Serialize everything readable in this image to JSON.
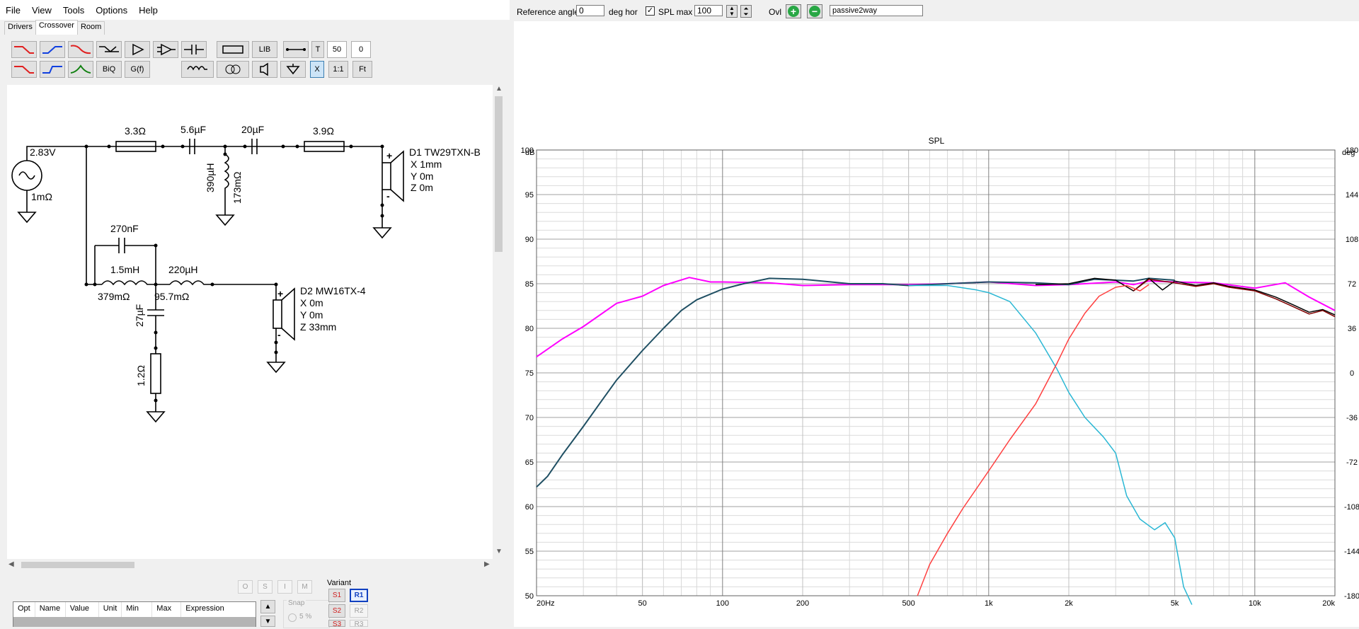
{
  "menu": [
    "File",
    "View",
    "Tools",
    "Options",
    "Help"
  ],
  "tabs": [
    {
      "label": "Drivers"
    },
    {
      "label": "Crossover",
      "active": true
    },
    {
      "label": "Room"
    }
  ],
  "toolbar": {
    "lib": "LIB",
    "t": "T",
    "val50": "50",
    "val0": "0",
    "biq": "BiQ",
    "gf": "G(f)",
    "x": "X",
    "one": "1:1",
    "fit": "Ft"
  },
  "schematic": {
    "source": {
      "voltage": "2.83V",
      "resistance": "1mΩ"
    },
    "tweeter_branch": {
      "r1": "3.3Ω",
      "c1": "5.6µF",
      "l1": "390µH",
      "l1r": "173mΩ",
      "c2": "20µF",
      "r2": "3.9Ω"
    },
    "woofer_branch": {
      "c1": "270nF",
      "l1": "1.5mH",
      "l1r": "379mΩ",
      "l2": "220µH",
      "l2r": "95.7mΩ",
      "c2": "27µF",
      "r1": "1.2Ω"
    },
    "drivers": [
      {
        "name": "D1 TW29TXN-B",
        "x": "X 1mm",
        "y": "Y 0m",
        "z": "Z 0m"
      },
      {
        "name": "D2 MW16TX-4",
        "x": "X 0m",
        "y": "Y 0m",
        "z": "Z 33mm"
      }
    ],
    "plus": "+",
    "minus": "-"
  },
  "bottom": {
    "buttons": [
      "O",
      "S",
      "I",
      "M"
    ],
    "snap": "Snap",
    "snap_val": "5 %",
    "variant_label": "Variant",
    "variants_s": [
      "S1",
      "S2",
      "S3"
    ],
    "variants_r": [
      "R1",
      "R2",
      "R3"
    ],
    "grid_cols": [
      "Opt",
      "Name",
      "Value",
      "Unit",
      "Min",
      "Max",
      "Expression"
    ]
  },
  "topbar": {
    "ref_angle_label": "Reference angle",
    "ref_angle_value": "0",
    "deg_hor": "deg hor",
    "spl_max_label": "SPL max",
    "spl_max_value": "100",
    "ovl_label": "Ovl",
    "project_name": "passive2way"
  },
  "chart_data": {
    "type": "line",
    "title": "SPL",
    "xscale": "log",
    "xlim": [
      20,
      20000
    ],
    "ylim": [
      50,
      100
    ],
    "y2lim": [
      -180,
      180
    ],
    "ylabel_unit": "dB",
    "y2label_unit": "deg",
    "xticks": [
      {
        "v": 20,
        "l": "20Hz"
      },
      {
        "v": 50,
        "l": "50"
      },
      {
        "v": 100,
        "l": "100"
      },
      {
        "v": 200,
        "l": "200"
      },
      {
        "v": 500,
        "l": "500"
      },
      {
        "v": 1000,
        "l": "1k"
      },
      {
        "v": 2000,
        "l": "2k"
      },
      {
        "v": 5000,
        "l": "5k"
      },
      {
        "v": 10000,
        "l": "10k"
      },
      {
        "v": 20000,
        "l": "20k"
      }
    ],
    "yticks": [
      50,
      55,
      60,
      65,
      70,
      75,
      80,
      85,
      90,
      95,
      100
    ],
    "y2ticks": [
      "-180",
      "-144",
      "-108",
      "-72",
      "-36",
      "0",
      "36",
      "72",
      "108",
      "144",
      "180"
    ],
    "grid": true,
    "series": [
      {
        "color": "#ff00ff",
        "x": [
          20,
          25,
          30,
          40,
          50,
          60,
          75,
          90,
          100,
          150,
          200,
          300,
          400,
          500,
          700,
          1000,
          1500,
          2000,
          3000,
          3500,
          4000,
          5000,
          7000,
          10000,
          13000,
          16000,
          20000
        ],
        "y": [
          76.8,
          78.8,
          80.2,
          82.8,
          83.6,
          84.8,
          85.7,
          85.2,
          85.2,
          85.1,
          84.8,
          84.9,
          84.9,
          84.9,
          85.0,
          85.2,
          84.8,
          84.9,
          85.2,
          84.9,
          85.3,
          85.2,
          85.1,
          84.5,
          85.1,
          83.5,
          82.0
        ]
      },
      {
        "color": "#1f4f63",
        "x": [
          20,
          22,
          25,
          30,
          35,
          40,
          50,
          60,
          70,
          80,
          100,
          120,
          150,
          200,
          300,
          400,
          500,
          700,
          1000,
          1500,
          2000,
          2500,
          3000,
          3500,
          4000,
          5000
        ],
        "y": [
          62.2,
          63.4,
          65.8,
          69.0,
          71.8,
          74.2,
          77.5,
          80.0,
          82.0,
          83.2,
          84.4,
          85.0,
          85.6,
          85.5,
          85.0,
          85.0,
          84.8,
          85.0,
          85.2,
          85.1,
          84.9,
          85.5,
          85.4,
          85.3,
          85.6,
          85.4
        ]
      },
      {
        "color": "#000000",
        "x": [
          1500,
          2000,
          2500,
          3000,
          3500,
          4000,
          4500,
          5000,
          6000,
          7000,
          8000,
          10000,
          12000,
          14000,
          16000,
          18000,
          20000
        ],
        "y": [
          84.9,
          85.0,
          85.6,
          85.4,
          84.2,
          85.6,
          84.3,
          85.3,
          84.8,
          85.1,
          84.7,
          84.3,
          83.5,
          82.6,
          81.8,
          82.1,
          81.5
        ]
      },
      {
        "color": "#800000",
        "x": [
          3500,
          4000,
          5000,
          6000,
          7000,
          8000,
          10000,
          12000,
          14000,
          16000,
          18000,
          20000
        ],
        "y": [
          84.2,
          85.5,
          85.1,
          84.7,
          85.0,
          84.6,
          84.2,
          83.3,
          82.4,
          81.6,
          82.0,
          81.3
        ]
      },
      {
        "color": "#2ab7d4",
        "x": [
          500,
          700,
          900,
          1000,
          1200,
          1500,
          1800,
          2000,
          2300,
          2700,
          3000,
          3300,
          3700,
          4200,
          4600,
          5000,
          5400,
          5800
        ],
        "y": [
          84.8,
          84.8,
          84.3,
          84.0,
          83.0,
          79.5,
          75.5,
          72.8,
          70.0,
          67.8,
          66.0,
          61.2,
          58.6,
          57.4,
          58.2,
          56.5,
          51.0,
          49.0
        ]
      },
      {
        "color": "#ff4040",
        "x": [
          540,
          600,
          700,
          800,
          1000,
          1200,
          1500,
          1800,
          2000,
          2300,
          2600,
          3000,
          3300,
          3700,
          4000
        ],
        "y": [
          50,
          53.5,
          57.0,
          59.8,
          64.0,
          67.5,
          71.5,
          76.0,
          78.8,
          81.7,
          83.6,
          84.6,
          84.8,
          84.2,
          84.9
        ]
      }
    ]
  }
}
